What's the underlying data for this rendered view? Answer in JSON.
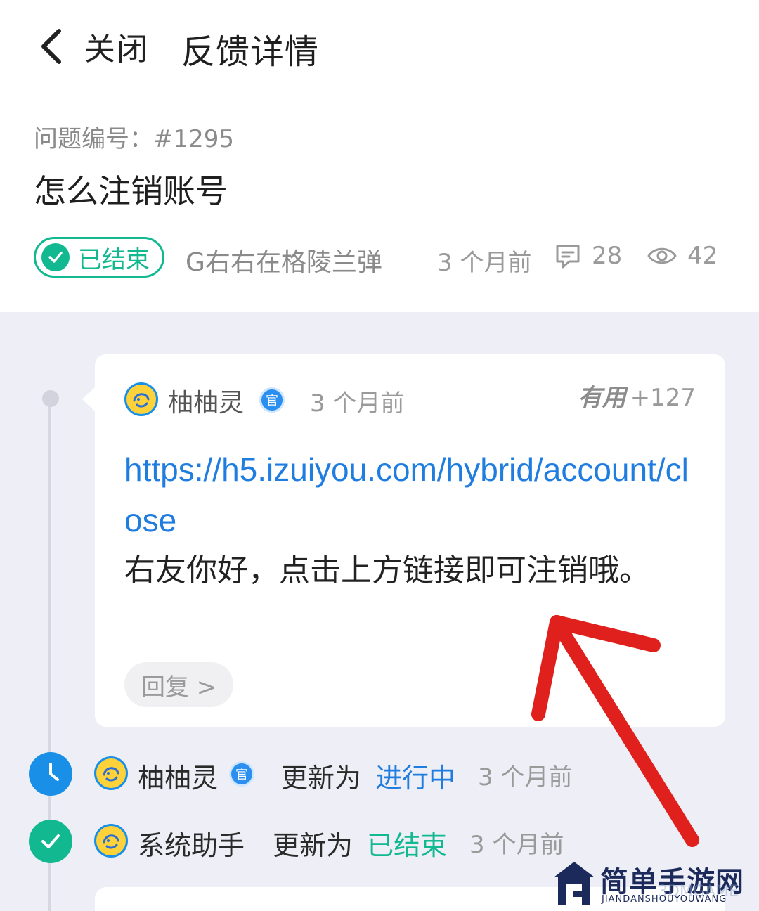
{
  "header": {
    "close_label": "关闭",
    "title": "反馈详情"
  },
  "issue": {
    "id_label": "问题编号：#1295",
    "title": "怎么注销账号",
    "status": "已结束",
    "author": "G右右在格陵兰弹",
    "time": "3 个月前",
    "comments": "28",
    "views": "42"
  },
  "reply": {
    "author": "柚柚灵",
    "official": "官",
    "time": "3 个月前",
    "useful_label": "有用",
    "useful_count": "+127",
    "link": "https://h5.izuiyou.com/hybrid/account/close",
    "text": "右友你好，点击上方链接即可注销哦。",
    "reply_button": "回复 >"
  },
  "events": [
    {
      "actor": "柚柚灵",
      "official": "官",
      "action": "更新为",
      "status": "进行中",
      "time": "3 个月前",
      "icon": "clock-icon"
    },
    {
      "actor": "系统助手",
      "action": "更新为",
      "status": "已结束",
      "time": "3 个月前",
      "icon": "check-icon"
    }
  ],
  "watermark": {
    "title": "简单手游网",
    "subtitle": "JIANDANSHOUYOUWANG",
    "faint": "3DMGAME"
  },
  "colors": {
    "accent_green": "#12b88f",
    "accent_blue": "#1f7de0",
    "annotation_red": "#e0201c"
  }
}
